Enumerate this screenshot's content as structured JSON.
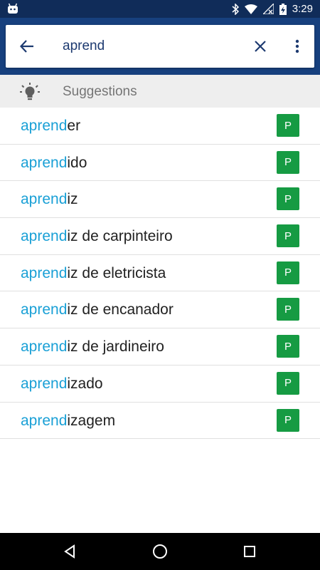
{
  "status_bar": {
    "time": "3:29",
    "icons": [
      "android-robot-icon",
      "bluetooth-icon",
      "wifi-icon",
      "signal-off-icon",
      "battery-charging-icon"
    ]
  },
  "search": {
    "query": "aprend",
    "back_icon": "arrow-left-icon",
    "clear_icon": "close-icon",
    "menu_icon": "more-vert-icon"
  },
  "suggestions": {
    "header_label": "Suggestions",
    "header_icon": "lightbulb-icon",
    "items": [
      {
        "match": "aprend",
        "rest": "er",
        "badge": "P"
      },
      {
        "match": "aprend",
        "rest": "ido",
        "badge": "P"
      },
      {
        "match": "aprend",
        "rest": "iz",
        "badge": "P"
      },
      {
        "match": "aprend",
        "rest": "iz de carpinteiro",
        "badge": "P"
      },
      {
        "match": "aprend",
        "rest": "iz de eletricista",
        "badge": "P"
      },
      {
        "match": "aprend",
        "rest": "iz de encanador",
        "badge": "P"
      },
      {
        "match": "aprend",
        "rest": "iz de jardineiro",
        "badge": "P"
      },
      {
        "match": "aprend",
        "rest": "izado",
        "badge": "P"
      },
      {
        "match": "aprend",
        "rest": "izagem",
        "badge": "P"
      }
    ]
  },
  "nav_bar": {
    "buttons": [
      "back-triangle-icon",
      "home-circle-icon",
      "recents-square-icon"
    ]
  },
  "colors": {
    "status_bar": "#102c59",
    "app_bar": "#17407e",
    "match_text": "#1aa0d6",
    "badge": "#169b43"
  }
}
